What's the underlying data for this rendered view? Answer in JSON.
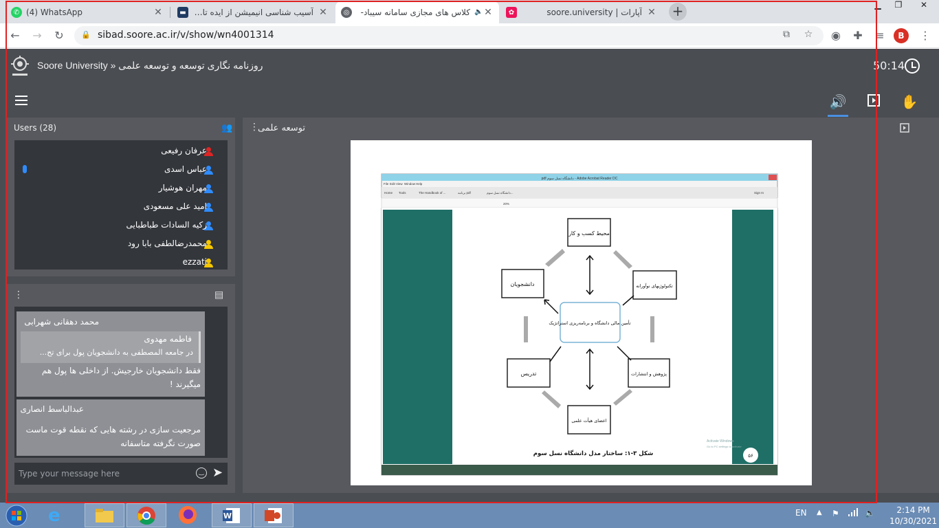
{
  "browser": {
    "tabs": [
      {
        "title": "(4) WhatsApp"
      },
      {
        "title": "آسیب شناسی انیمیشن از ایده تا بازاریابی -"
      },
      {
        "title": "کلاس های مجازی سامانه سیباد-"
      },
      {
        "title": "آپارات | soore.university"
      }
    ],
    "url": "sibad.soore.ac.ir/v/show/wn4001314",
    "profile_initial": "B"
  },
  "app": {
    "title": "Soore University » روزنامه نگاری توسعه و توسعه علمی",
    "clock": "50:14"
  },
  "users": {
    "header": "Users (28)",
    "list": [
      {
        "name": "عرفان رفیعی",
        "color": "#e02424"
      },
      {
        "name": "عباس اسدی",
        "color": "#2f8cff",
        "talking": true
      },
      {
        "name": "مهران هوشیار",
        "color": "#2f8cff"
      },
      {
        "name": "امید علی مسعودی",
        "color": "#2f8cff"
      },
      {
        "name": "زکیه السادات طباطبایی",
        "color": "#2f8cff"
      },
      {
        "name": "محمدرضالطفی بابا رود",
        "color": "#f6c700"
      },
      {
        "name": "ezzati",
        "color": "#f6c700"
      }
    ]
  },
  "chat": {
    "messages": [
      {
        "sender": "محمد دهقانی شهرابی",
        "quote_name": "فاطمه مهدوی",
        "quote_text": "در جامعه المصطفی به دانشجویان پول برای تح...",
        "body_line1": "فقط دانشجویان خارجیش. از داخلی ها پول هم",
        "body_line2": "میگیرند !"
      },
      {
        "sender": "عبدالباسط انصاری",
        "body_line1": "مرجعیت سازی در رشته هایی که نقطه قوت ماست",
        "body_line2": "صورت نگرفته متاسفانه"
      }
    ],
    "input_placeholder": "Type your message here"
  },
  "presentation": {
    "title": "توسعه علمی",
    "slide": {
      "reader_title": "pdf دانشگاه نسل سوم - Adobe Acrobat Reader DC",
      "menu": [
        "File",
        "Edit",
        "View",
        "Window",
        "Help"
      ],
      "reader_tabs": [
        "Home",
        "Tools",
        "The Handbook of ...",
        "برنامه pdf",
        "دانشگاه نسل سوم..."
      ],
      "sign_in": "Sign In",
      "zoom": "20%",
      "center": "تأمین مالی دانشگاه و برنامه‌ریزی استراتژیک",
      "nodes": [
        "محیط کسب و کار",
        "تکنولوژیهای نوآورانه",
        "پژوهش و انتشارات",
        "اعضای هیأت علمی",
        "تدریس",
        "دانشجویان"
      ],
      "caption": "شکل ۳-۱: ساختار مدل دانشگاه نسل سوم",
      "page_num": "۵۶",
      "watermark_line1": "Activate Windows",
      "watermark_line2": "Go to PC settings to activate"
    }
  },
  "taskbar": {
    "lang": "EN",
    "time": "2:14 PM",
    "date": "10/30/2021"
  }
}
